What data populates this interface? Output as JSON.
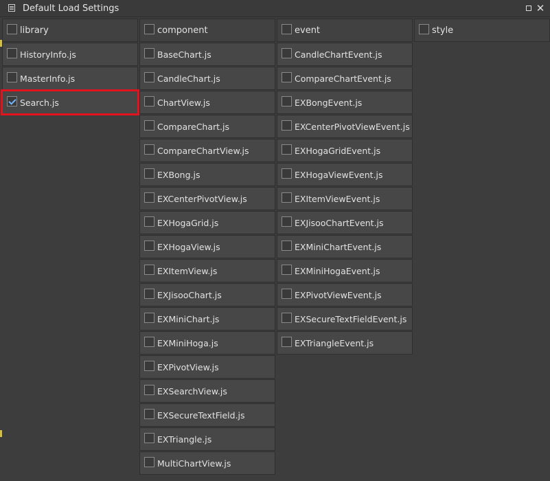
{
  "window": {
    "title": "Default Load Settings",
    "icon": "settings-window-icon",
    "close_label": "✕"
  },
  "columns": [
    {
      "header": {
        "label": "library",
        "checked": false
      },
      "items": [
        {
          "label": "HistoryInfo.js",
          "checked": false
        },
        {
          "label": "MasterInfo.js",
          "checked": false
        },
        {
          "label": "Search.js",
          "checked": true,
          "highlighted": true
        }
      ]
    },
    {
      "header": {
        "label": "component",
        "checked": false
      },
      "items": [
        {
          "label": "BaseChart.js",
          "checked": false
        },
        {
          "label": "CandleChart.js",
          "checked": false
        },
        {
          "label": "ChartView.js",
          "checked": false
        },
        {
          "label": "CompareChart.js",
          "checked": false
        },
        {
          "label": "CompareChartView.js",
          "checked": false
        },
        {
          "label": "EXBong.js",
          "checked": false
        },
        {
          "label": "EXCenterPivotView.js",
          "checked": false
        },
        {
          "label": "EXHogaGrid.js",
          "checked": false
        },
        {
          "label": "EXHogaView.js",
          "checked": false
        },
        {
          "label": "EXItemView.js",
          "checked": false
        },
        {
          "label": "EXJisooChart.js",
          "checked": false
        },
        {
          "label": "EXMiniChart.js",
          "checked": false
        },
        {
          "label": "EXMiniHoga.js",
          "checked": false
        },
        {
          "label": "EXPivotView.js",
          "checked": false
        },
        {
          "label": "EXSearchView.js",
          "checked": false
        },
        {
          "label": "EXSecureTextField.js",
          "checked": false
        },
        {
          "label": "EXTriangle.js",
          "checked": false
        },
        {
          "label": "MultiChartView.js",
          "checked": false
        }
      ]
    },
    {
      "header": {
        "label": "event",
        "checked": false
      },
      "items": [
        {
          "label": "CandleChartEvent.js",
          "checked": false
        },
        {
          "label": "CompareChartEvent.js",
          "checked": false
        },
        {
          "label": "EXBongEvent.js",
          "checked": false
        },
        {
          "label": "EXCenterPivotViewEvent.js",
          "checked": false
        },
        {
          "label": "EXHogaGridEvent.js",
          "checked": false
        },
        {
          "label": "EXHogaViewEvent.js",
          "checked": false
        },
        {
          "label": "EXItemViewEvent.js",
          "checked": false
        },
        {
          "label": "EXJisooChartEvent.js",
          "checked": false
        },
        {
          "label": "EXMiniChartEvent.js",
          "checked": false
        },
        {
          "label": "EXMiniHogaEvent.js",
          "checked": false
        },
        {
          "label": "EXPivotViewEvent.js",
          "checked": false
        },
        {
          "label": "EXSecureTextFieldEvent.js",
          "checked": false
        },
        {
          "label": "EXTriangleEvent.js",
          "checked": false
        }
      ]
    },
    {
      "header": {
        "label": "style",
        "checked": false
      },
      "items": []
    }
  ],
  "colors": {
    "background": "#3d3d3d",
    "cell": "#474747",
    "highlight": "#e3121c",
    "check": "#6fb6ff"
  }
}
